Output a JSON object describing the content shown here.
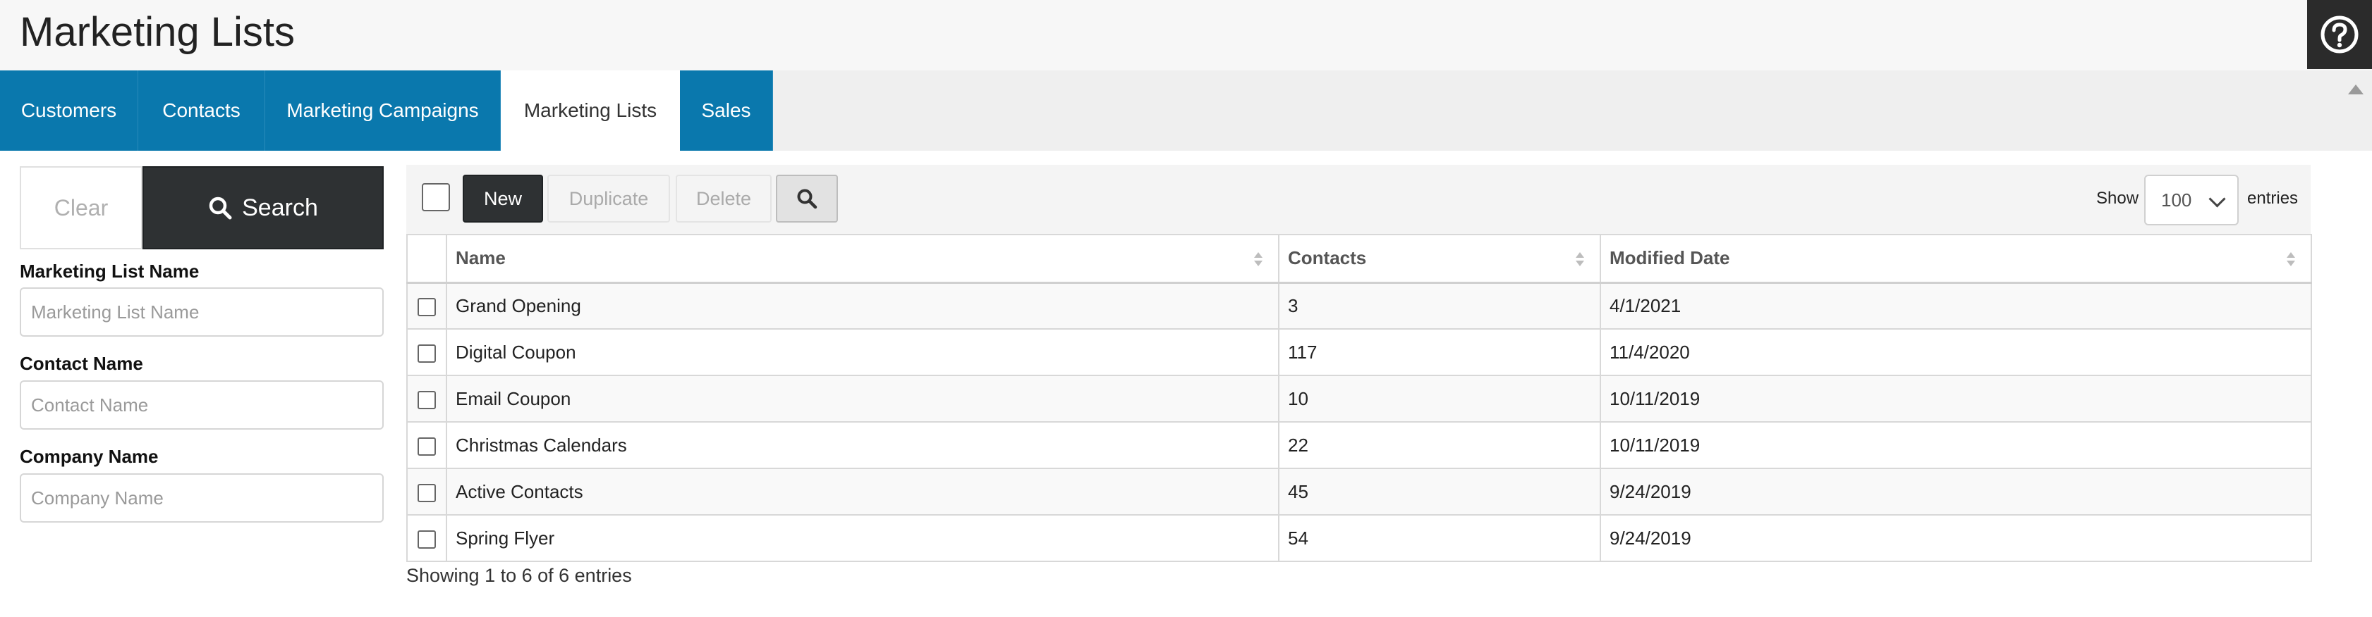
{
  "header": {
    "title": "Marketing Lists"
  },
  "tabs": [
    {
      "label": "Customers"
    },
    {
      "label": "Contacts"
    },
    {
      "label": "Marketing Campaigns"
    },
    {
      "label": "Marketing Lists",
      "active": true
    },
    {
      "label": "Sales"
    }
  ],
  "search_panel": {
    "clear_label": "Clear",
    "search_label": "Search",
    "fields": [
      {
        "label": "Marketing List Name",
        "placeholder": "Marketing List Name",
        "value": ""
      },
      {
        "label": "Contact Name",
        "placeholder": "Contact Name",
        "value": ""
      },
      {
        "label": "Company Name",
        "placeholder": "Company Name",
        "value": ""
      }
    ]
  },
  "toolbar": {
    "new_label": "New",
    "duplicate_label": "Duplicate",
    "delete_label": "Delete",
    "show_label": "Show",
    "entries_value": "100",
    "entries_label": "entries"
  },
  "table": {
    "columns": [
      "Name",
      "Contacts",
      "Modified Date"
    ],
    "rows": [
      {
        "name": "Grand Opening",
        "contacts": "3",
        "modified": "4/1/2021"
      },
      {
        "name": "Digital Coupon",
        "contacts": "117",
        "modified": "11/4/2020"
      },
      {
        "name": "Email Coupon",
        "contacts": "10",
        "modified": "10/11/2019"
      },
      {
        "name": "Christmas Calendars",
        "contacts": "22",
        "modified": "10/11/2019"
      },
      {
        "name": "Active Contacts",
        "contacts": "45",
        "modified": "9/24/2019"
      },
      {
        "name": "Spring Flyer",
        "contacts": "54",
        "modified": "9/24/2019"
      }
    ],
    "info": "Showing 1 to 6 of 6 entries"
  },
  "colors": {
    "tab_blue": "#0a78ad",
    "dark_button": "#2e3133",
    "header_bg": "#f7f7f7"
  },
  "icons": {
    "help": "help-circle-icon",
    "search": "magnifier-icon",
    "sort": "sort-arrows-icon"
  }
}
